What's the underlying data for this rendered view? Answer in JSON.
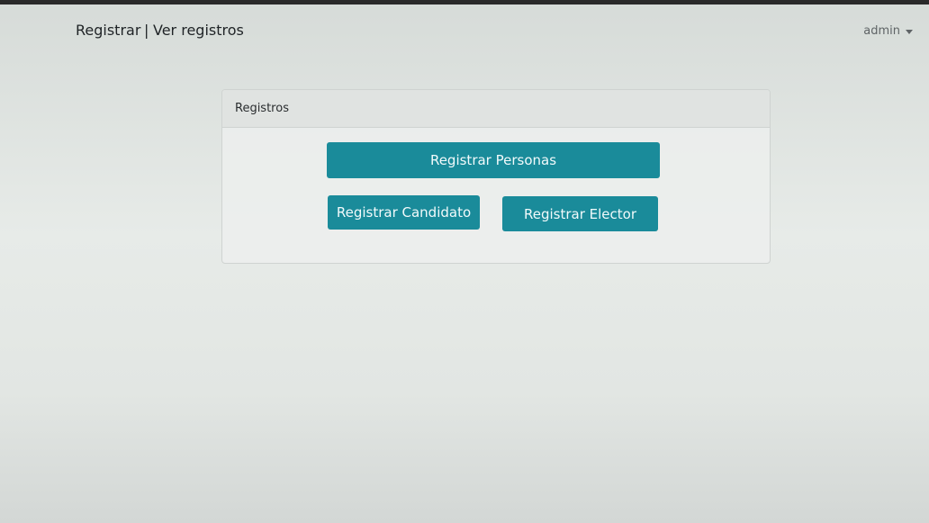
{
  "navbar": {
    "register_link": "Registrar",
    "separator": "|",
    "view_records_link": "Ver registros",
    "user_menu": {
      "label": "admin",
      "caret_icon": "caret-down-icon"
    }
  },
  "panel": {
    "heading": "Registros",
    "buttons": {
      "register_people": "Registrar Personas",
      "register_candidate": "Registrar Candidato",
      "register_voter": "Registrar Elector"
    }
  },
  "colors": {
    "button_primary": "#1a8b9a",
    "button_text": "#f2fafb"
  }
}
